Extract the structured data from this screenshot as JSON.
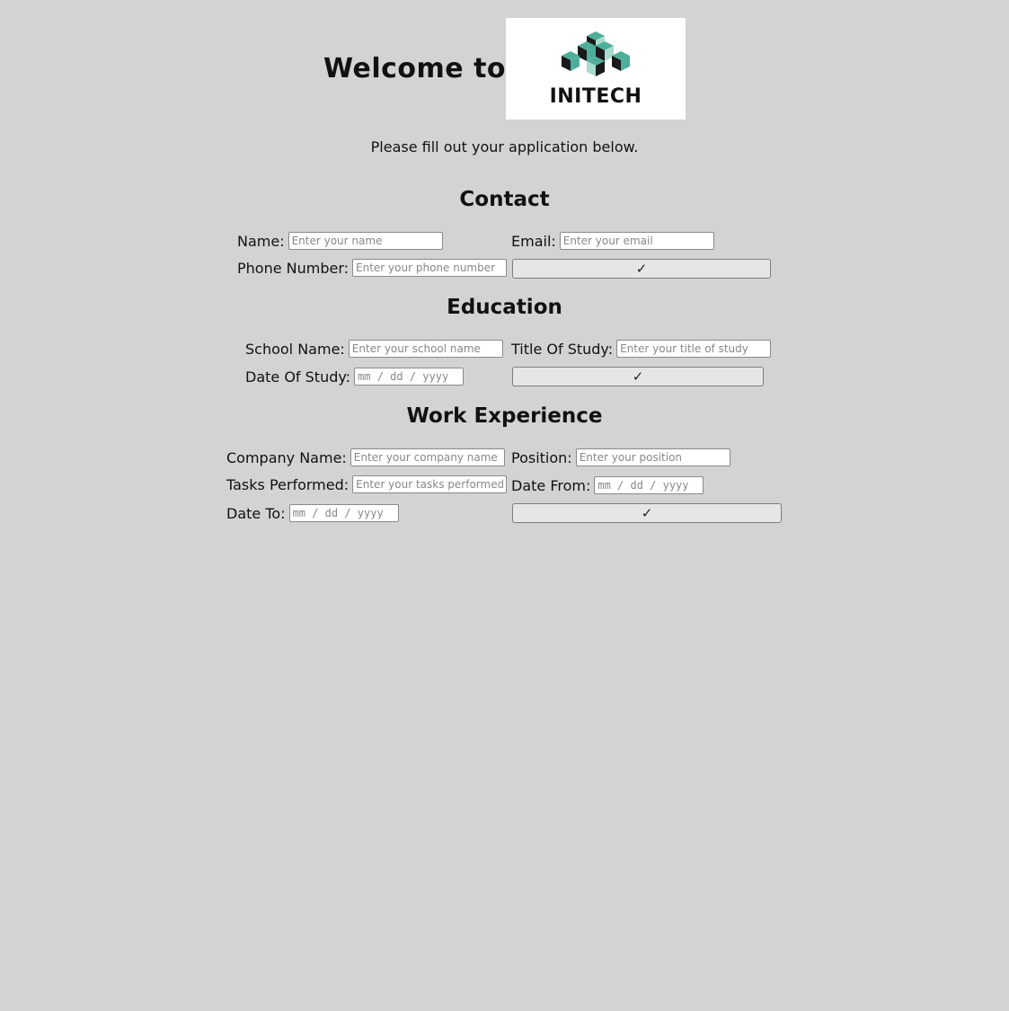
{
  "header": {
    "welcome_text": "Welcome to",
    "logo_text": "INITECH",
    "logo_colors": {
      "teal": "#4fae9a",
      "dark": "#1a1a1a",
      "light": "#a9dccf"
    }
  },
  "intro": "Please fill out your application below.",
  "contact": {
    "title": "Contact",
    "name_label": "Name:",
    "name_placeholder": "Enter your name",
    "email_label": "Email:",
    "email_placeholder": "Enter your email",
    "phone_label": "Phone Number:",
    "phone_placeholder": "Enter your phone number",
    "submit_icon": "✓"
  },
  "education": {
    "title": "Education",
    "school_label": "School Name:",
    "school_placeholder": "Enter your school name",
    "study_title_label": "Title Of Study:",
    "study_title_placeholder": "Enter your title of study",
    "date_label": "Date Of Study:",
    "date_placeholder": "mm / dd / yyyy",
    "submit_icon": "✓"
  },
  "work": {
    "title": "Work Experience",
    "company_label": "Company Name:",
    "company_placeholder": "Enter your company name",
    "position_label": "Position:",
    "position_placeholder": "Enter your position",
    "tasks_label": "Tasks Performed:",
    "tasks_placeholder": "Enter your tasks performed",
    "date_from_label": "Date From:",
    "date_from_placeholder": "mm / dd / yyyy",
    "date_to_label": "Date To:",
    "date_to_placeholder": "mm / dd / yyyy",
    "submit_icon": "✓"
  }
}
